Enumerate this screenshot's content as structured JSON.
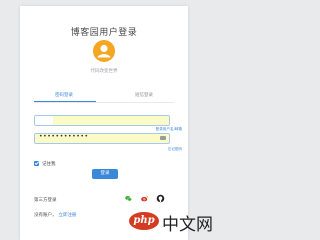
{
  "header": {
    "title": "博客园用户登录",
    "slogan": "代码改变世界"
  },
  "avatar": {
    "icon": "user-icon",
    "color": "#f5a623"
  },
  "tabs": [
    {
      "label": "密码登录",
      "active": true
    },
    {
      "label": "短信登录",
      "active": false
    }
  ],
  "form": {
    "username_value": "",
    "username_hint": "登录用户名/邮箱",
    "password_value": "••••••••••••",
    "password_hint": "忘记密码",
    "remember_label": "记住我",
    "remember_checked": true,
    "login_label": "登录"
  },
  "third_party": {
    "label": "第三方登录",
    "providers": [
      {
        "name": "wechat-icon",
        "color": "#3cb034"
      },
      {
        "name": "weibo-icon",
        "color": "#d52b1e"
      },
      {
        "name": "github-icon",
        "color": "#222222"
      }
    ]
  },
  "signup": {
    "prompt": "没有账户，",
    "link": "立即注册"
  },
  "watermark": {
    "logo": "php",
    "text": "中文网"
  },
  "colors": {
    "accent": "#3a88d8",
    "background": "#e9eaec",
    "autofill": "#fafbc6"
  }
}
